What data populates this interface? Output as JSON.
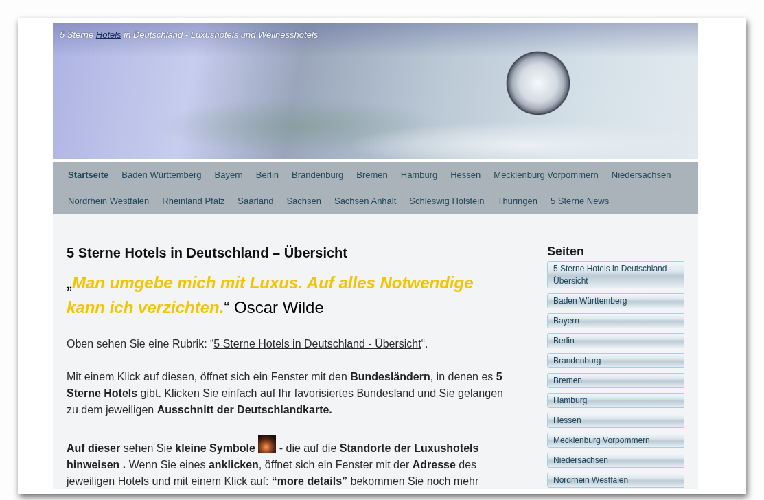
{
  "header": {
    "tagline": {
      "before": "5 Sterne ",
      "link": "Hotels",
      "after": " in Deutschland - Luxushotels und Wellnesshotels"
    }
  },
  "nav": {
    "items": [
      {
        "label": "Startseite",
        "selected": true
      },
      {
        "label": "Baden Württemberg",
        "selected": false
      },
      {
        "label": "Bayern",
        "selected": false
      },
      {
        "label": "Berlin",
        "selected": false
      },
      {
        "label": "Brandenburg",
        "selected": false
      },
      {
        "label": "Bremen",
        "selected": false
      },
      {
        "label": "Hamburg",
        "selected": false
      },
      {
        "label": "Hessen",
        "selected": false
      },
      {
        "label": "Mecklenburg Vorpommern",
        "selected": false
      },
      {
        "label": "Niedersachsen",
        "selected": false
      },
      {
        "label": "Nordrhein Westfalen",
        "selected": false
      },
      {
        "label": "Rheinland Pfalz",
        "selected": false
      },
      {
        "label": "Saarland",
        "selected": false
      },
      {
        "label": "Sachsen",
        "selected": false
      },
      {
        "label": "Sachsen Anhalt",
        "selected": false
      },
      {
        "label": "Schleswig Holstein",
        "selected": false
      },
      {
        "label": "Thüringen",
        "selected": false
      },
      {
        "label": "5 Sterne News",
        "selected": false
      }
    ]
  },
  "main": {
    "title": "5 Sterne Hotels in Deutschland – Übersicht",
    "quote": "„*Man umgebe mich mit Luxus. Auf alles Notwendige kann ich verzichten.*“ Oscar Wilde",
    "paragraphs": [
      {
        "kind": "link",
        "before": "Oben sehen Sie eine Rubrik: “",
        "link": "5 Sterne Hotels in Deutschland - Übersicht",
        "after": "“."
      },
      {
        "kind": "text",
        "text": "Mit einem Klick auf diesen, öffnet sich ein Fenster mit den **Bundesländern**, in denen es **5 Sterne Hotels** gibt. Klicken Sie einfach auf Ihr favorisiertes Bundesland und Sie gelangen zu dem jeweiligen **Ausschnitt der Deutschlandkarte.**"
      },
      {
        "kind": "icon",
        "before": "**Auf dieser** sehen Sie **kleine Symbole**",
        "after": " - die auf die **Standorte der Luxushotels hinweisen .** Wenn Sie eines **anklicken**, öffnet sich ein Fenster mit der **Adresse** des jeweiligen Hotels und mit einem Klick auf: **“more details”** bekommen Sie noch mehr"
      }
    ]
  },
  "sidebar": {
    "title": "Seiten",
    "items": [
      "5 Sterne Hotels in Deutschland - Übersicht",
      "Baden Württemberg",
      "Bayern",
      "Berlin",
      "Brandenburg",
      "Bremen",
      "Hamburg",
      "Hessen",
      "Mecklenburg Vorpommern",
      "Niedersachsen",
      "Nordrhein Westfalen"
    ]
  }
}
